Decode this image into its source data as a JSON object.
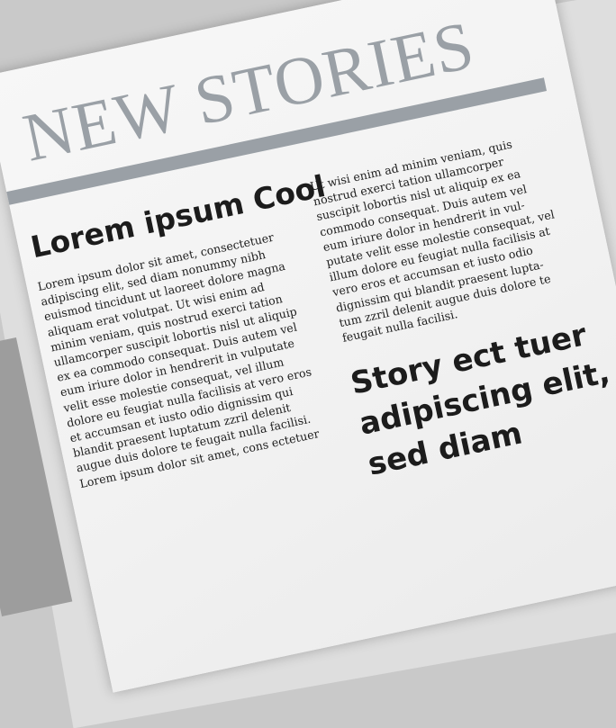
{
  "masthead": {
    "title": "NEW STORIES",
    "accent_color": "#9aa0a6"
  },
  "story1": {
    "headline": "Lorem ipsum Cool",
    "lines": [
      "Lorem ipsum dolor sit amet, consectetuer",
      "adipiscing elit, sed diam nonummy nibh",
      "euismod tincidunt ut laoreet dolore magna",
      "aliquam erat volutpat. Ut wisi enim ad",
      "minim veniam, quis nostrud exerci tation",
      "ullamcorper suscipit lobortis nisl ut aliquip",
      "ex ea commodo consequat. Duis autem vel",
      "eum iriure dolor in hendrerit in vulputate",
      "velit esse molestie consequat, vel illum",
      "dolore eu feugiat nulla facilisis at vero eros",
      "et accumsan et iusto odio dignissim qui",
      "blandit praesent luptatum zzril delenit",
      "augue duis dolore te feugait nulla facilisi.",
      "Lorem ipsum dolor sit amet, cons ectetuer"
    ]
  },
  "story2": {
    "lines": [
      "Ut wisi enim ad minim veniam, quis",
      "nostrud exerci tation ullamcorper",
      "suscipit lobortis nisl ut aliquip ex ea",
      "commodo consequat. Duis autem vel",
      "eum iriure dolor in hendrerit in vul-",
      "putate velit esse molestie consequat, vel",
      "illum dolore eu feugiat nulla facilisis at",
      "vero eros et accumsan et iusto odio",
      "dignissim qui blandit praesent lupta-",
      "tum zzril delenit augue duis dolore te",
      "feugait nulla facilisi."
    ]
  },
  "story3": {
    "headline_lines": [
      "Story ect tuer",
      "adipiscing elit,",
      "sed diam"
    ]
  }
}
